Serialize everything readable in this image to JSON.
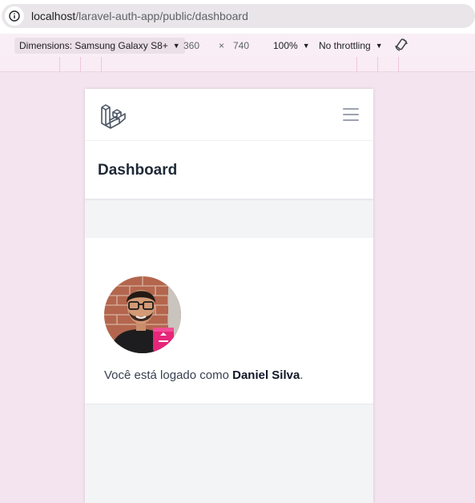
{
  "browser": {
    "url_host": "localhost",
    "url_path": "/laravel-auth-app/public/dashboard"
  },
  "device_toolbar": {
    "device": "Dimensions: Samsung Galaxy S8+",
    "width": "360",
    "times": "×",
    "height": "740",
    "zoom": "100%",
    "throttling": "No throttling"
  },
  "app": {
    "logo_icon": "laravel-logo-icon",
    "menu_icon": "hamburger-menu-icon",
    "page_title": "Dashboard",
    "welcome_prefix": "Você está logado como ",
    "user_name": "Daniel Silva",
    "welcome_suffix": ".",
    "accent_color": "#ff2d20"
  }
}
